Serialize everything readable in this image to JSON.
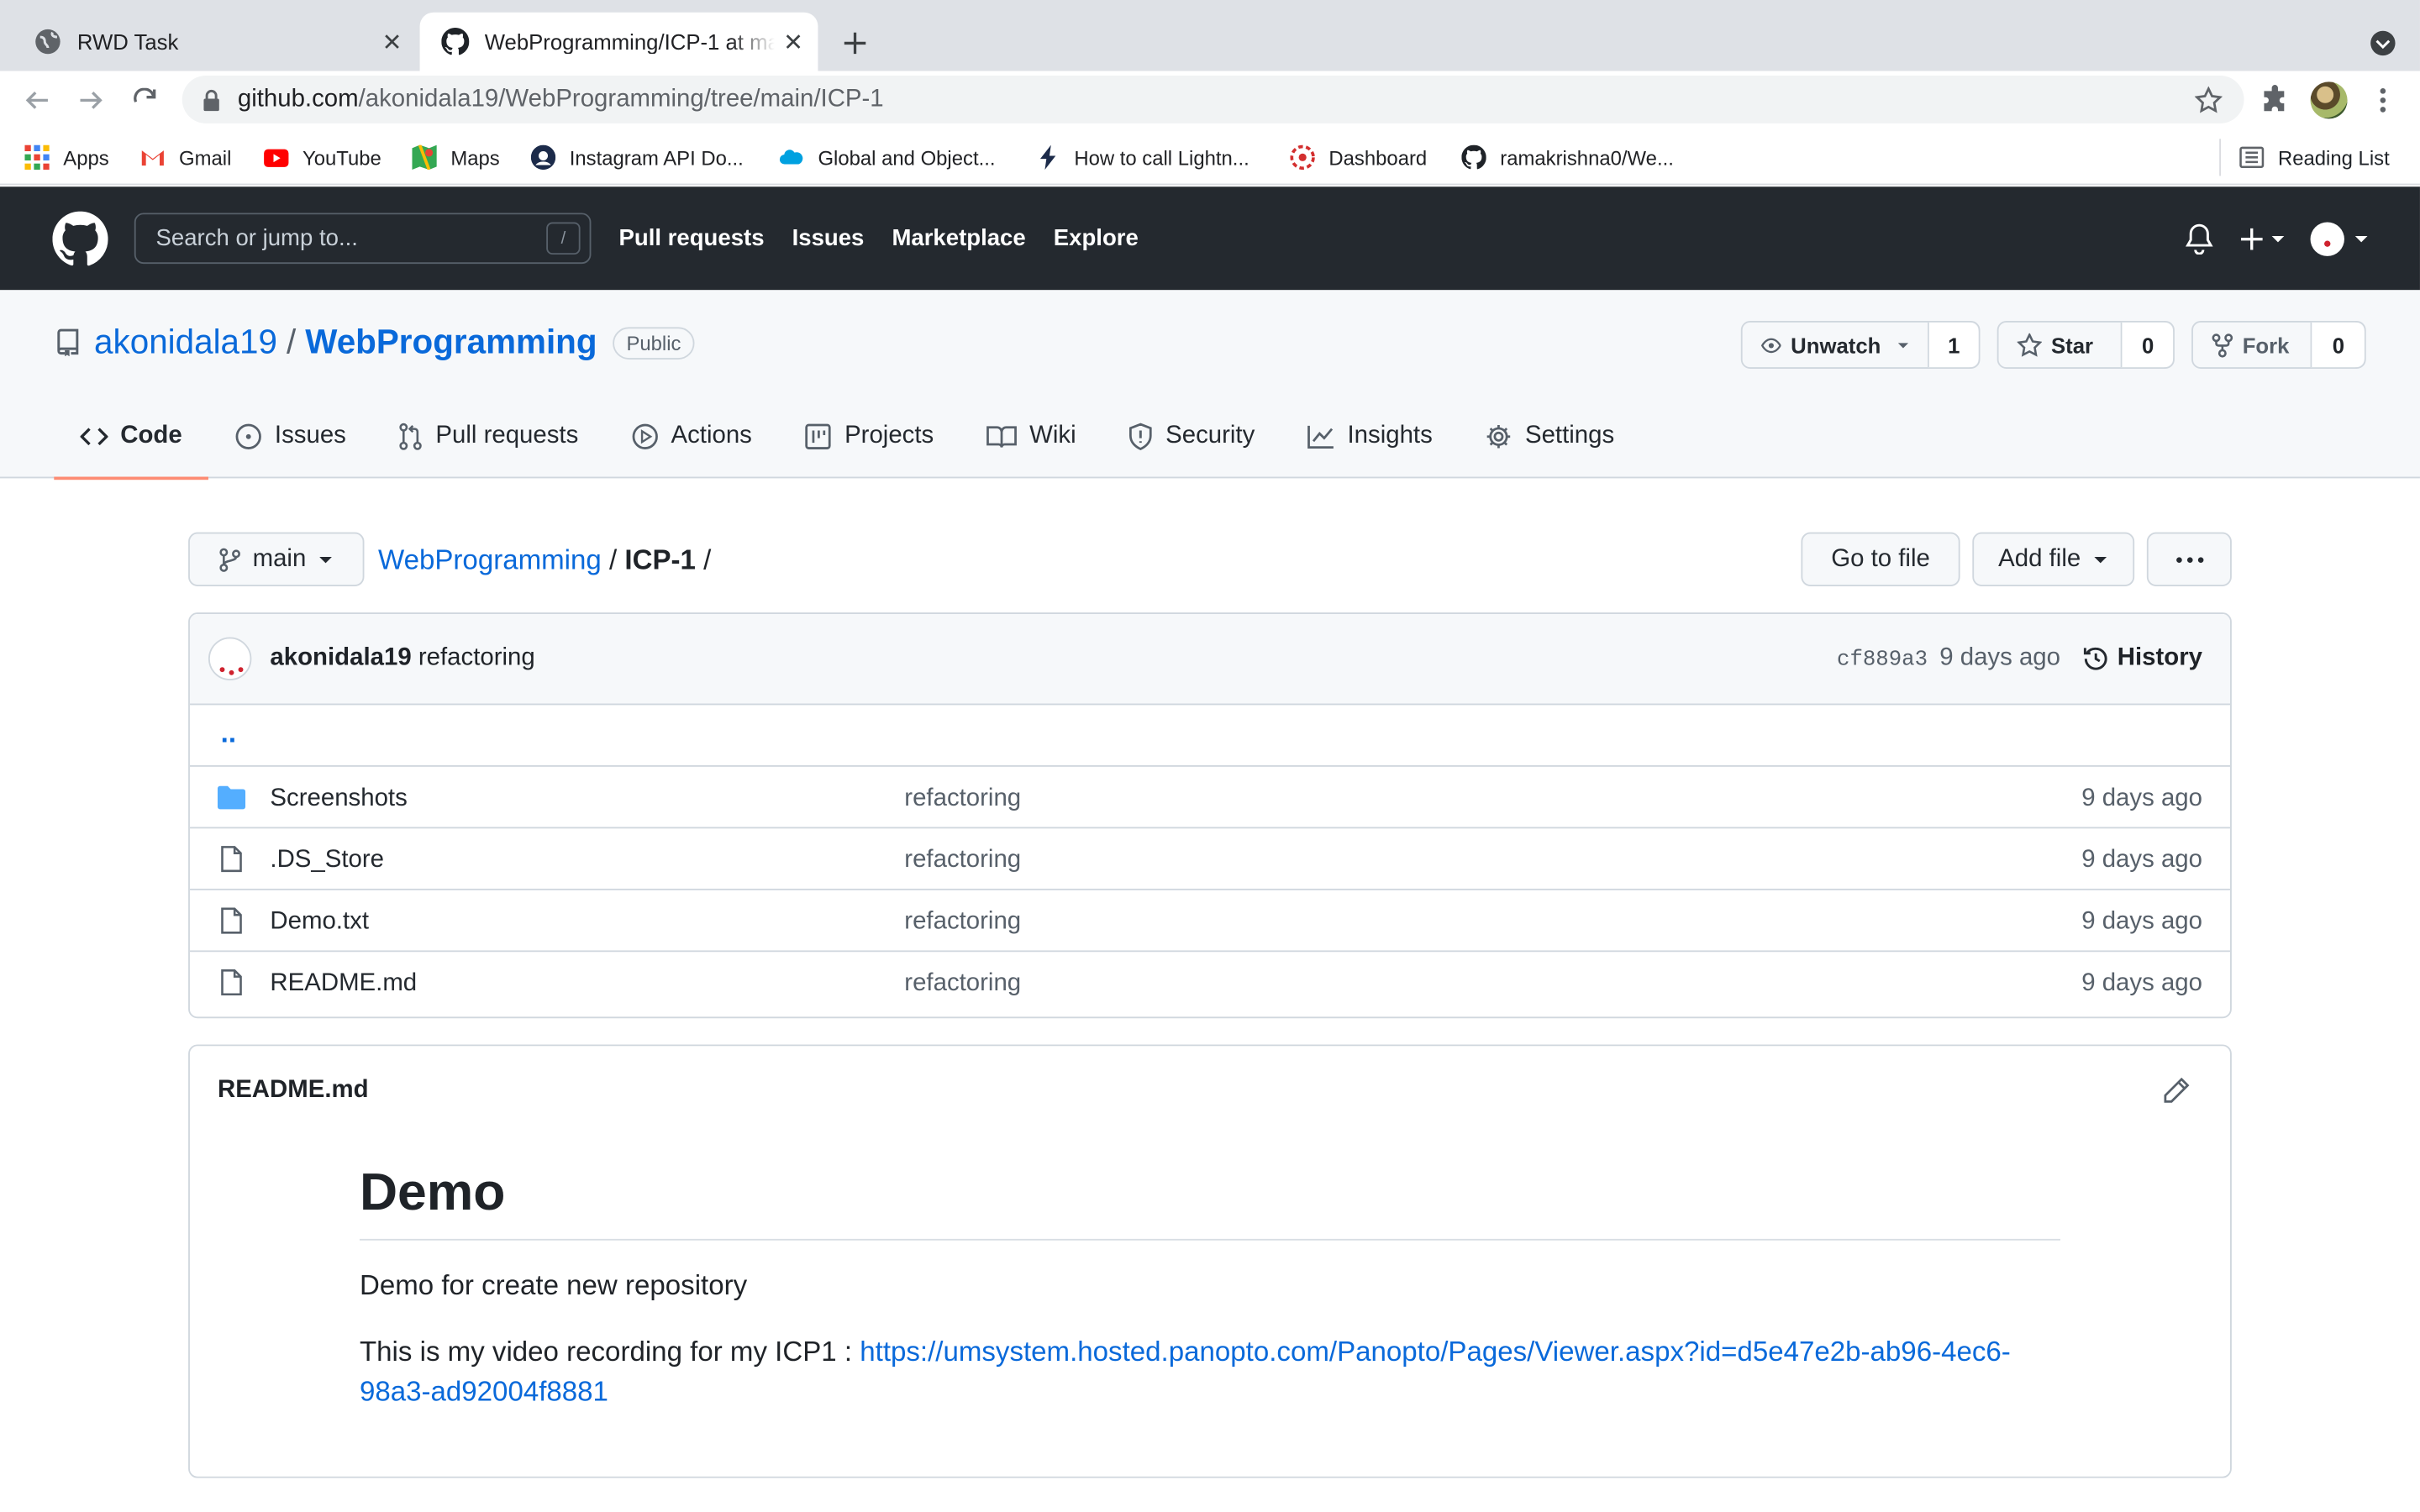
{
  "browser": {
    "tabs": [
      {
        "title": "RWD Task"
      },
      {
        "title": "WebProgramming/ICP-1 at main · akonidala19/WebProgramming"
      }
    ],
    "url": {
      "host": "github.com",
      "path": "/akonidala19/WebProgramming/tree/main/ICP-1"
    },
    "bookmarks": [
      "Apps",
      "Gmail",
      "YouTube",
      "Maps",
      "Instagram API Do...",
      "Global and Object...",
      "How to call Lightn...",
      "Dashboard",
      "ramakrishna0/We..."
    ],
    "reading_list": "Reading List"
  },
  "github": {
    "search_placeholder": "Search or jump to...",
    "search_key": "/",
    "nav": [
      "Pull requests",
      "Issues",
      "Marketplace",
      "Explore"
    ]
  },
  "repo": {
    "owner": "akonidala19",
    "name": "WebProgramming",
    "visibility": "Public",
    "watch": {
      "label": "Unwatch",
      "count": "1"
    },
    "star": {
      "label": "Star",
      "count": "0"
    },
    "fork": {
      "label": "Fork",
      "count": "0"
    },
    "tabs": [
      "Code",
      "Issues",
      "Pull requests",
      "Actions",
      "Projects",
      "Wiki",
      "Security",
      "Insights",
      "Settings"
    ]
  },
  "filenav": {
    "branch": "main",
    "crumb_root": "WebProgramming",
    "crumb_current": "ICP-1",
    "go_to_file": "Go to file",
    "add_file": "Add file"
  },
  "commit": {
    "author": "akonidala19",
    "message": "refactoring",
    "sha": "cf889a3",
    "age": "9 days ago",
    "history": "History"
  },
  "updir": "..",
  "files": [
    {
      "name": "Screenshots",
      "type": "folder",
      "message": "refactoring",
      "age": "9 days ago"
    },
    {
      "name": ".DS_Store",
      "type": "file",
      "message": "refactoring",
      "age": "9 days ago"
    },
    {
      "name": "Demo.txt",
      "type": "file",
      "message": "refactoring",
      "age": "9 days ago"
    },
    {
      "name": "README.md",
      "type": "file",
      "message": "refactoring",
      "age": "9 days ago"
    }
  ],
  "readme": {
    "filename": "README.md",
    "heading": "Demo",
    "paragraph1": "Demo for create new repository",
    "paragraph2_prefix": "This is my video recording for my ICP1 : ",
    "link": "https://umsystem.hosted.panopto.com/Panopto/Pages/Viewer.aspx?id=d5e47e2b-ab96-4ec6-98a3-ad92004f8881"
  },
  "colors": {
    "accent": "#0969da",
    "header_bg": "#24292f",
    "tab_underline": "#fd8c73",
    "folder": "#54aeff"
  }
}
